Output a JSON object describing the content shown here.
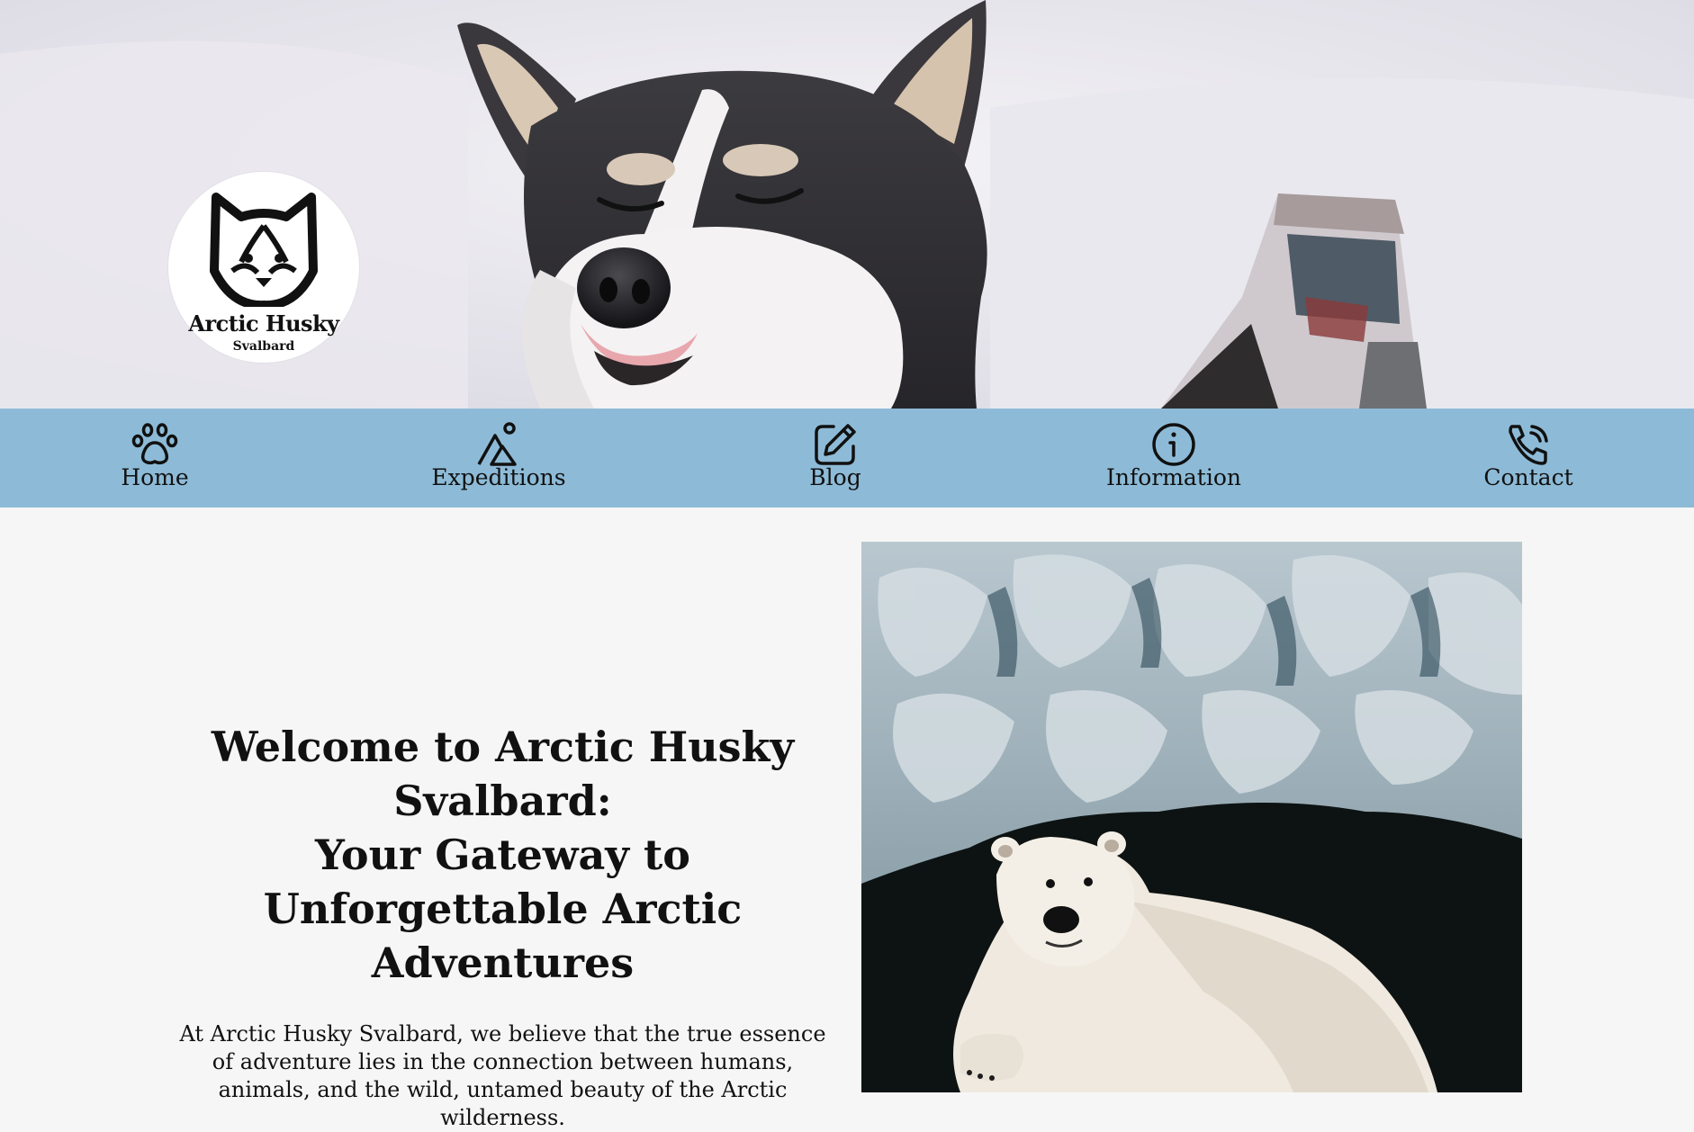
{
  "brand": {
    "name": "Arctic Husky",
    "subtitle": "Svalbard"
  },
  "nav": {
    "items": [
      {
        "label": "Home",
        "icon": "paw-icon"
      },
      {
        "label": "Expeditions",
        "icon": "mountain-icon"
      },
      {
        "label": "Blog",
        "icon": "edit-icon"
      },
      {
        "label": "Information",
        "icon": "info-icon"
      },
      {
        "label": "Contact",
        "icon": "phone-icon"
      }
    ]
  },
  "main": {
    "heading_line1": "Welcome to Arctic Husky Svalbard:",
    "heading_line2": "Your Gateway to Unforgettable Arctic Adventures",
    "intro": "At Arctic Husky Svalbard, we believe that the true essence of adventure lies in the connection between humans, animals, and the wild, untamed beauty of the Arctic wilderness."
  },
  "colors": {
    "nav_background": "#8dbbd7",
    "page_background": "#f6f6f6",
    "text": "#111111"
  }
}
